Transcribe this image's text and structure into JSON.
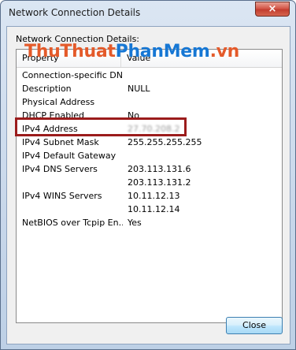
{
  "window": {
    "title": "Network Connection Details",
    "close_glyph": "×"
  },
  "group_label": "Network Connection Details:",
  "watermark": {
    "part1": "ThuThuat",
    "part2": "PhanMem",
    "part3": ".vn"
  },
  "columns": [
    "Property",
    "Value"
  ],
  "rows": [
    {
      "property": "Connection-specific DN...",
      "value": ""
    },
    {
      "property": "Description",
      "value": "NULL"
    },
    {
      "property": "Physical Address",
      "value": ""
    },
    {
      "property": "DHCP Enabled",
      "value": "No"
    },
    {
      "property": "IPv4 Address",
      "value": "27.70.208.2"
    },
    {
      "property": "IPv4 Subnet Mask",
      "value": "255.255.255.255"
    },
    {
      "property": "IPv4 Default Gateway",
      "value": ""
    },
    {
      "property": "IPv4 DNS Servers",
      "value": "203.113.131.6"
    },
    {
      "property": "",
      "value": "203.113.131.2"
    },
    {
      "property": "IPv4 WINS Servers",
      "value": "10.11.12.13"
    },
    {
      "property": "",
      "value": "10.11.12.14"
    },
    {
      "property": "NetBIOS over Tcpip En...",
      "value": "Yes"
    }
  ],
  "buttons": {
    "close": "Close"
  },
  "colors": {
    "highlight": "#9b1c1c",
    "watermark_a": "#e45a2a",
    "watermark_b": "#1677d4"
  }
}
